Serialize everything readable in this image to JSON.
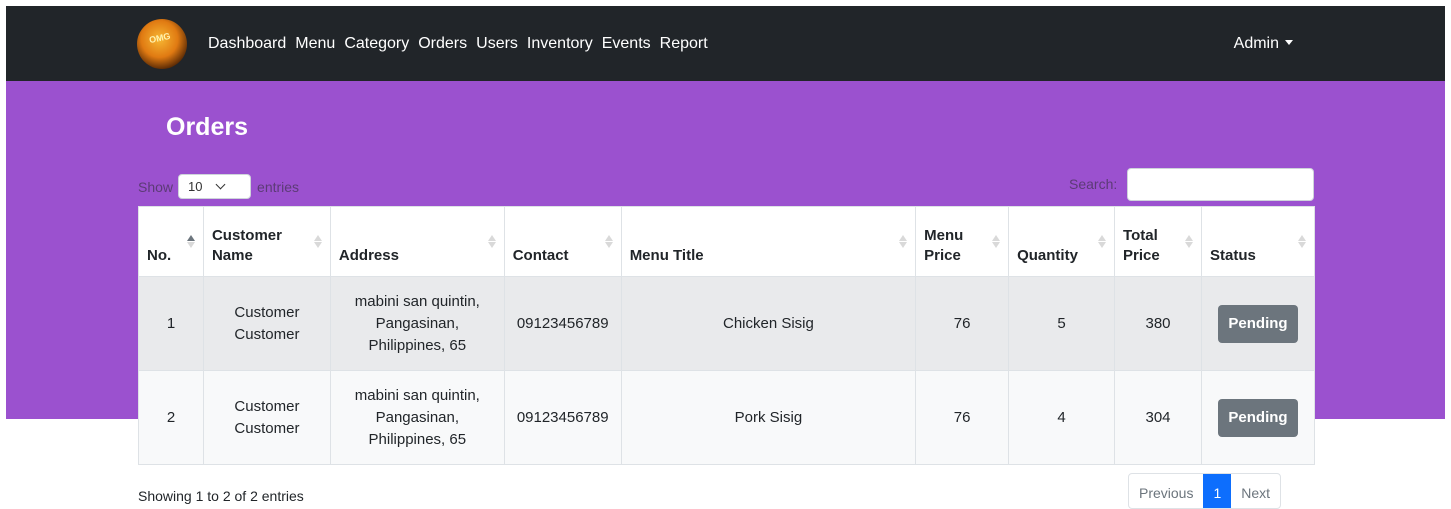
{
  "nav": {
    "logo_text": "OMG",
    "links": [
      "Dashboard",
      "Menu",
      "Category",
      "Orders",
      "Users",
      "Inventory",
      "Events",
      "Report"
    ],
    "user": "Admin"
  },
  "page": {
    "title": "Orders"
  },
  "controls": {
    "show_label": "Show",
    "entries_value": "10",
    "entries_label": "entries",
    "search_label": "Search:",
    "search_value": ""
  },
  "table": {
    "headers": [
      "No.",
      "Customer Name",
      "Address",
      "Contact",
      "Menu Title",
      "Menu Price",
      "Quantity",
      "Total Price",
      "Status"
    ],
    "rows": [
      {
        "no": "1",
        "customer": "Customer Customer",
        "address": "mabini san quintin, Pangasinan, Philippines, 65",
        "contact": "09123456789",
        "menu_title": "Chicken Sisig",
        "menu_price": "76",
        "quantity": "5",
        "total_price": "380",
        "status": "Pending"
      },
      {
        "no": "2",
        "customer": "Customer Customer",
        "address": "mabini san quintin, Pangasinan, Philippines, 65",
        "contact": "09123456789",
        "menu_title": "Pork Sisig",
        "menu_price": "76",
        "quantity": "4",
        "total_price": "304",
        "status": "Pending"
      }
    ]
  },
  "footer": {
    "info": "Showing 1 to 2 of 2 entries",
    "previous": "Previous",
    "page": "1",
    "next": "Next"
  },
  "colors": {
    "navbar": "#212529",
    "hero": "#9b51cf",
    "badge": "#6c757d",
    "page_active": "#0d6efd"
  }
}
